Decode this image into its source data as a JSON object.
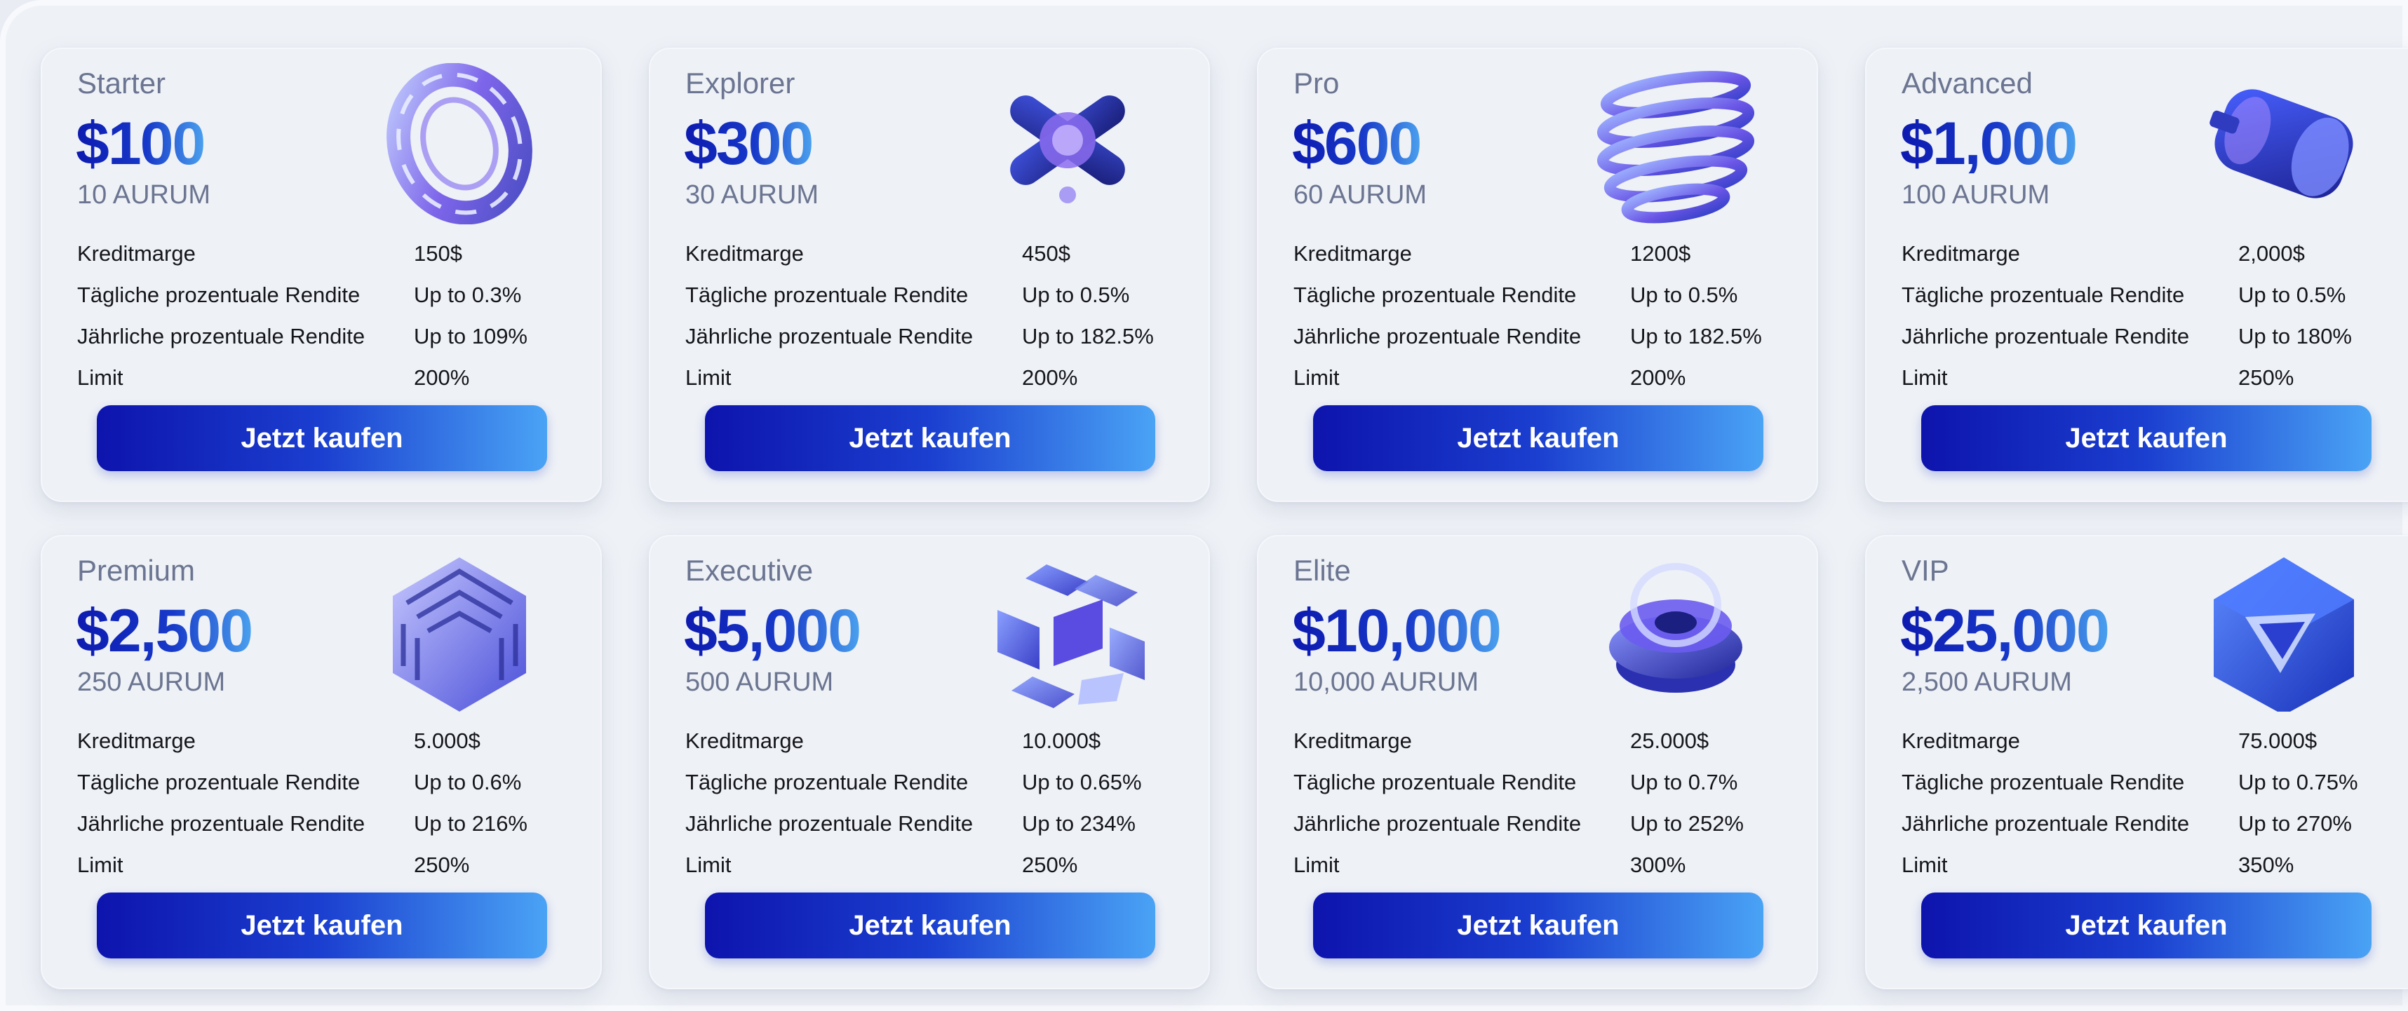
{
  "plans": [
    {
      "name": "Starter",
      "price": "$100",
      "tokens": "10 AURUM",
      "icon": "glass-ring-icon",
      "rows": [
        [
          "Kreditmarge",
          "150$"
        ],
        [
          "Tägliche prozentuale Rendite",
          "Up to 0.3%"
        ],
        [
          "Jährliche prozentuale Rendite",
          "Up to 109%"
        ],
        [
          "Limit",
          "200%"
        ]
      ],
      "button": "Jetzt kaufen"
    },
    {
      "name": "Explorer",
      "price": "$300",
      "tokens": "30 AURUM",
      "icon": "cross-knot-icon",
      "rows": [
        [
          "Kreditmarge",
          "450$"
        ],
        [
          "Tägliche prozentuale Rendite",
          "Up to 0.5%"
        ],
        [
          "Jährliche prozentuale Rendite",
          "Up to 182.5%"
        ],
        [
          "Limit",
          "200%"
        ]
      ],
      "button": "Jetzt kaufen"
    },
    {
      "name": "Pro",
      "price": "$600",
      "tokens": "60 AURUM",
      "icon": "spiral-sphere-icon",
      "rows": [
        [
          "Kreditmarge",
          "1200$"
        ],
        [
          "Tägliche prozentuale Rendite",
          "Up to 0.5%"
        ],
        [
          "Jährliche prozentuale Rendite",
          "Up to 182.5%"
        ],
        [
          "Limit",
          "200%"
        ]
      ],
      "button": "Jetzt kaufen"
    },
    {
      "name": "Advanced",
      "price": "$1,000",
      "tokens": "100 AURUM",
      "icon": "cylinder-capsule-icon",
      "rows": [
        [
          "Kreditmarge",
          "2,000$"
        ],
        [
          "Tägliche prozentuale Rendite",
          "Up to 0.5%"
        ],
        [
          "Jährliche prozentuale Rendite",
          "Up to 180%"
        ],
        [
          "Limit",
          "250%"
        ]
      ],
      "button": "Jetzt kaufen"
    },
    {
      "name": "Premium",
      "price": "$2,500",
      "tokens": "250 AURUM",
      "icon": "maze-cube-icon",
      "rows": [
        [
          "Kreditmarge",
          "5.000$"
        ],
        [
          "Tägliche prozentuale Rendite",
          "Up to 0.6%"
        ],
        [
          "Jährliche prozentuale Rendite",
          "Up to 216%"
        ],
        [
          "Limit",
          "250%"
        ]
      ],
      "button": "Jetzt kaufen"
    },
    {
      "name": "Executive",
      "price": "$5,000",
      "tokens": "500 AURUM",
      "icon": "exploded-cube-icon",
      "rows": [
        [
          "Kreditmarge",
          "10.000$"
        ],
        [
          "Tägliche prozentuale Rendite",
          "Up to 0.65%"
        ],
        [
          "Jährliche prozentuale Rendite",
          "Up to 234%"
        ],
        [
          "Limit",
          "250%"
        ]
      ],
      "button": "Jetzt kaufen"
    },
    {
      "name": "Elite",
      "price": "$10,000",
      "tokens": "10,000 AURUM",
      "icon": "ring-stack-icon",
      "rows": [
        [
          "Kreditmarge",
          "25.000$"
        ],
        [
          "Tägliche prozentuale Rendite",
          "Up to 0.7%"
        ],
        [
          "Jährliche prozentuale Rendite",
          "Up to 252%"
        ],
        [
          "Limit",
          "300%"
        ]
      ],
      "button": "Jetzt kaufen"
    },
    {
      "name": "VIP",
      "price": "$25,000",
      "tokens": "2,500 AURUM",
      "icon": "glass-cube-icon",
      "rows": [
        [
          "Kreditmarge",
          "75.000$"
        ],
        [
          "Tägliche prozentuale Rendite",
          "Up to 0.75%"
        ],
        [
          "Jährliche prozentuale Rendite",
          "Up to 270%"
        ],
        [
          "Limit",
          "350%"
        ]
      ],
      "button": "Jetzt kaufen"
    }
  ],
  "colors": {
    "accent_dark": "#0d14ad",
    "accent_light": "#4aa3f5",
    "label_gray": "#6b7591",
    "card_bg": "#eef1f6"
  }
}
